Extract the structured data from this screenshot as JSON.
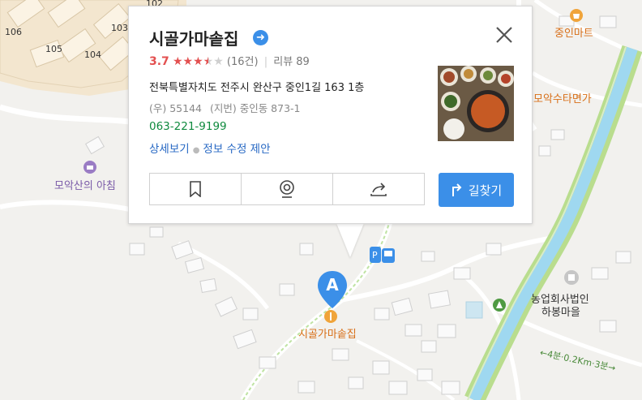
{
  "map": {
    "building_numbers": [
      "106",
      "105",
      "104",
      "103",
      "102"
    ],
    "pois": [
      {
        "name": "중인마트",
        "icon": "shopping-icon"
      },
      {
        "name": "모악수타면가"
      },
      {
        "name": "모악산의 아침",
        "icon": "lodging-icon"
      },
      {
        "name": "농업회사법인\n하봉마을"
      },
      {
        "name": "시골가마솥집",
        "icon": "restaurant-icon"
      }
    ],
    "poi_line1": "농업회사법인",
    "poi_line2": "하봉마을",
    "trail_label": "←4분·0.2Km·3분→",
    "marker_letter": "A",
    "colors": {
      "accent": "#3b8fe8",
      "poi_orange": "#d86f18",
      "poi_purple": "#7a5aa8",
      "phone_green": "#0f8a3e",
      "star_red": "#e35050",
      "stream": "#9fd8f0",
      "greenway": "#b9dd8e"
    }
  },
  "place": {
    "name": "시골가마솥집",
    "rating": "3.7",
    "stars_filled": 3.5,
    "stars_total": 5,
    "review_count": "(16건)",
    "review_label": "리뷰 89",
    "address": "전북특별자치도 전주시 완산구 중인1길 163 1층",
    "postal": "(우) 55144",
    "jibun": "(지번) 중인동 873-1",
    "phone": "063-221-9199",
    "link_detail": "상세보기",
    "link_edit": "정보 수정 제안",
    "route_label": "길찾기",
    "actions": [
      "bookmark-icon",
      "roadview-icon",
      "share-icon"
    ]
  }
}
